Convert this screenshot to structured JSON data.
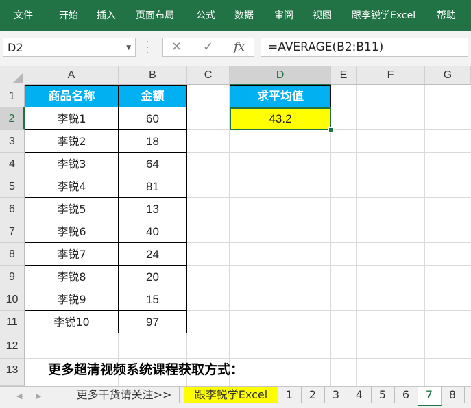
{
  "ribbon": {
    "tabs": [
      "文件",
      "开始",
      "插入",
      "页面布局",
      "公式",
      "数据",
      "审阅",
      "视图",
      "跟李锐学Excel",
      "帮助"
    ]
  },
  "formula_bar": {
    "name_box": "D2",
    "cancel_symbol": "✕",
    "enter_symbol": "✓",
    "fx_symbol": "fx",
    "formula": "=AVERAGE(B2:B11)"
  },
  "grid": {
    "columns": [
      "A",
      "B",
      "C",
      "D",
      "E",
      "F",
      "G"
    ],
    "active_column": "D",
    "rows": [
      "1",
      "2",
      "3",
      "4",
      "5",
      "6",
      "7",
      "8",
      "9",
      "10",
      "11",
      "12",
      "13"
    ],
    "active_row": "2"
  },
  "table": {
    "headers": [
      "商品名称",
      "金额"
    ],
    "rows": [
      {
        "name": "李锐1",
        "amount": "60"
      },
      {
        "name": "李锐2",
        "amount": "18"
      },
      {
        "name": "李锐3",
        "amount": "64"
      },
      {
        "name": "李锐4",
        "amount": "81"
      },
      {
        "name": "李锐5",
        "amount": "13"
      },
      {
        "name": "李锐6",
        "amount": "40"
      },
      {
        "name": "李锐7",
        "amount": "24"
      },
      {
        "name": "李锐8",
        "amount": "20"
      },
      {
        "name": "李锐9",
        "amount": "15"
      },
      {
        "name": "李锐10",
        "amount": "97"
      }
    ],
    "header_color": "#00b0f0"
  },
  "average": {
    "label": "求平均值",
    "value": "43.2",
    "highlight_color": "#ffff00"
  },
  "footer_text": "更多超清视频系统课程获取方式：",
  "sheet_tabs": {
    "tabs": [
      "更多干货请关注>>",
      "跟李锐学Excel",
      "1",
      "2",
      "3",
      "4",
      "5",
      "6",
      "7",
      "8"
    ],
    "active": "7",
    "highlighted": "跟李锐学Excel"
  },
  "colors": {
    "ribbon": "#217346",
    "accent": "#217346"
  }
}
